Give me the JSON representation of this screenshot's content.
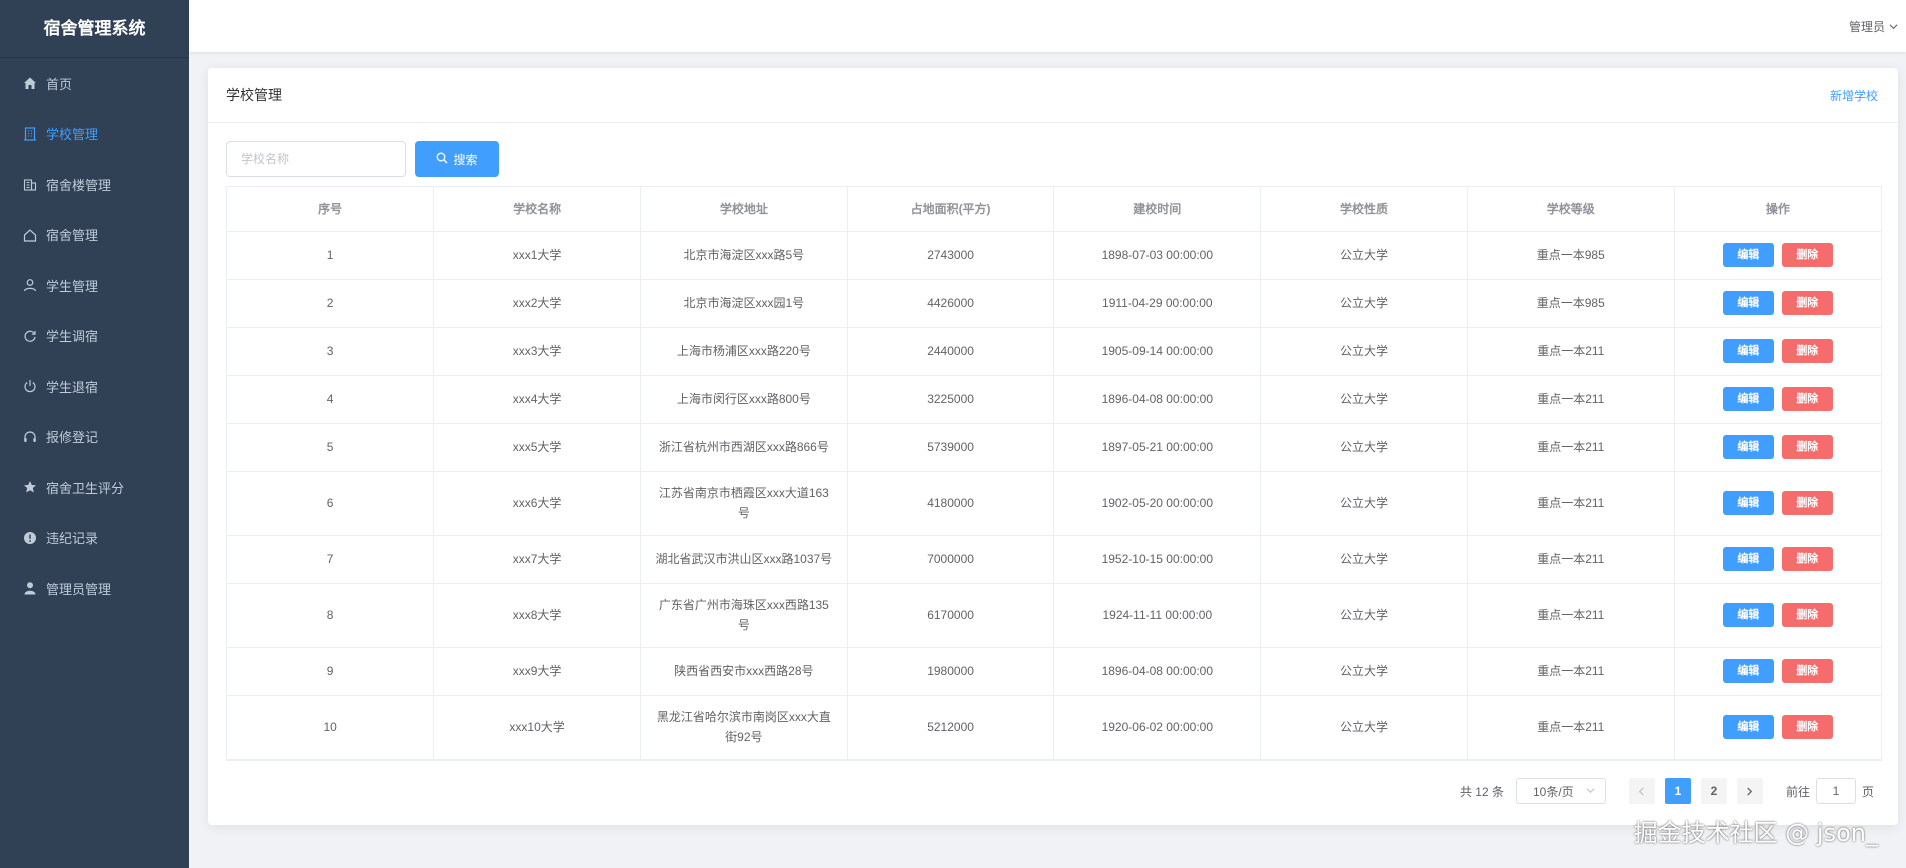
{
  "app": {
    "title": "宿舍管理系统"
  },
  "sidebar": {
    "items": [
      {
        "label": "首页",
        "icon": "home-icon"
      },
      {
        "label": "学校管理",
        "icon": "building-icon",
        "active": true
      },
      {
        "label": "宿舍楼管理",
        "icon": "office-icon"
      },
      {
        "label": "宿舍管理",
        "icon": "house-icon"
      },
      {
        "label": "学生管理",
        "icon": "user-icon"
      },
      {
        "label": "学生调宿",
        "icon": "refresh-icon"
      },
      {
        "label": "学生退宿",
        "icon": "power-icon"
      },
      {
        "label": "报修登记",
        "icon": "headset-icon"
      },
      {
        "label": "宿舍卫生评分",
        "icon": "star-icon"
      },
      {
        "label": "违纪记录",
        "icon": "warning-icon"
      },
      {
        "label": "管理员管理",
        "icon": "person-icon"
      }
    ]
  },
  "header": {
    "user": "管理员"
  },
  "page": {
    "title": "学校管理",
    "add_label": "新增学校",
    "search": {
      "placeholder": "学校名称",
      "button_label": "搜索"
    }
  },
  "table": {
    "columns": [
      "序号",
      "学校名称",
      "学校地址",
      "占地面积(平方)",
      "建校时间",
      "学校性质",
      "学校等级",
      "操作"
    ],
    "edit_label": "编辑",
    "delete_label": "删除",
    "rows": [
      {
        "no": "1",
        "name": "xxx1大学",
        "address": "北京市海淀区xxx路5号",
        "area": "2743000",
        "founded": "1898-07-03 00:00:00",
        "type": "公立大学",
        "level": "重点一本985"
      },
      {
        "no": "2",
        "name": "xxx2大学",
        "address": "北京市海淀区xxx园1号",
        "area": "4426000",
        "founded": "1911-04-29 00:00:00",
        "type": "公立大学",
        "level": "重点一本985"
      },
      {
        "no": "3",
        "name": "xxx3大学",
        "address": "上海市杨浦区xxx路220号",
        "area": "2440000",
        "founded": "1905-09-14 00:00:00",
        "type": "公立大学",
        "level": "重点一本211"
      },
      {
        "no": "4",
        "name": "xxx4大学",
        "address": "上海市闵行区xxx路800号",
        "area": "3225000",
        "founded": "1896-04-08 00:00:00",
        "type": "公立大学",
        "level": "重点一本211"
      },
      {
        "no": "5",
        "name": "xxx5大学",
        "address": "浙江省杭州市西湖区xxx路866号",
        "area": "5739000",
        "founded": "1897-05-21 00:00:00",
        "type": "公立大学",
        "level": "重点一本211"
      },
      {
        "no": "6",
        "name": "xxx6大学",
        "address": "江苏省南京市栖霞区xxx大道163号",
        "area": "4180000",
        "founded": "1902-05-20 00:00:00",
        "type": "公立大学",
        "level": "重点一本211"
      },
      {
        "no": "7",
        "name": "xxx7大学",
        "address": "湖北省武汉市洪山区xxx路1037号",
        "area": "7000000",
        "founded": "1952-10-15 00:00:00",
        "type": "公立大学",
        "level": "重点一本211"
      },
      {
        "no": "8",
        "name": "xxx8大学",
        "address": "广东省广州市海珠区xxx西路135号",
        "area": "6170000",
        "founded": "1924-11-11 00:00:00",
        "type": "公立大学",
        "level": "重点一本211"
      },
      {
        "no": "9",
        "name": "xxx9大学",
        "address": "陕西省西安市xxx西路28号",
        "area": "1980000",
        "founded": "1896-04-08 00:00:00",
        "type": "公立大学",
        "level": "重点一本211"
      },
      {
        "no": "10",
        "name": "xxx10大学",
        "address": "黑龙江省哈尔滨市南岗区xxx大直街92号",
        "area": "5212000",
        "founded": "1920-06-02 00:00:00",
        "type": "公立大学",
        "level": "重点一本211"
      }
    ]
  },
  "pagination": {
    "total": "共 12 条",
    "page_size": "10条/页",
    "pages": [
      "1",
      "2"
    ],
    "current": "1",
    "goto_prefix": "前往",
    "goto_value": "1",
    "goto_suffix": "页"
  },
  "watermark": "掘金技术社区 @ json_",
  "colors": {
    "sidebar_bg": "#304156",
    "primary": "#409eff",
    "danger": "#f56c6c"
  }
}
